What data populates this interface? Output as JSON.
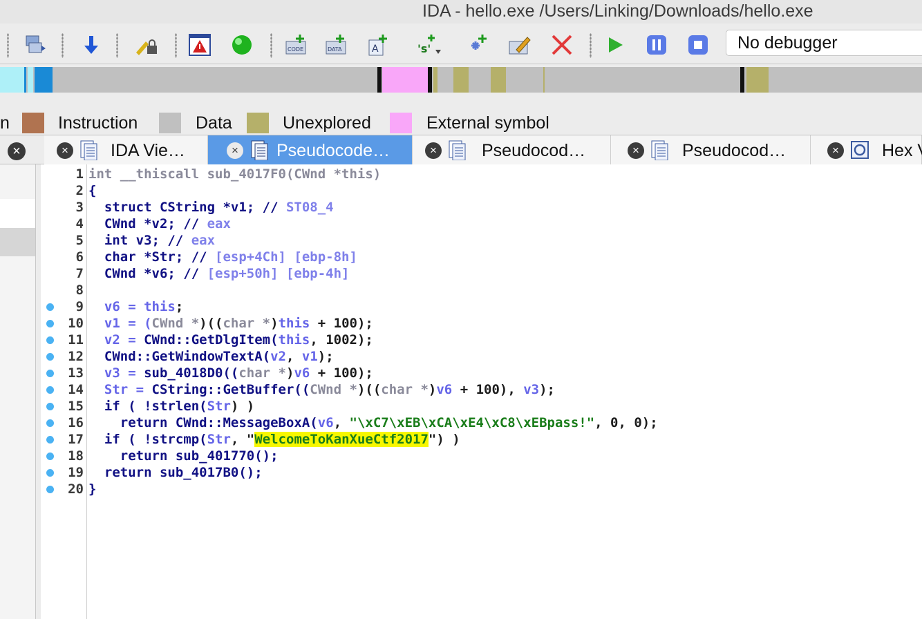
{
  "window": {
    "title": "IDA - hello.exe /Users/Linking/Downloads/hello.exe"
  },
  "toolbar": {
    "debugger_select": "No debugger",
    "icons": [
      "open-binary-icon",
      "jump-arrow-icon",
      "lock-key-icon",
      "warning-window-icon",
      "run-green-circle-icon",
      "code-add-icon",
      "data-add-icon",
      "string-add-icon",
      "segment-add-icon",
      "struct-add-icon",
      "edit-pencil-icon",
      "delete-x-icon",
      "play-icon",
      "pause-icon",
      "stop-icon"
    ]
  },
  "legend": {
    "items": [
      {
        "label": "n",
        "color": ""
      },
      {
        "label": "Instruction",
        "color": "#b07350"
      },
      {
        "label": "Data",
        "color": "#c0c0c0"
      },
      {
        "label": "Unexplored",
        "color": "#b5b06a"
      },
      {
        "label": "External symbol",
        "color": "#f9a7f9"
      }
    ]
  },
  "tabs": [
    {
      "label": "IDA Vie…",
      "active": false
    },
    {
      "label": "Pseudocode…",
      "active": true
    },
    {
      "label": "Pseudocod…",
      "active": false
    },
    {
      "label": "Pseudocod…",
      "active": false
    },
    {
      "label": "Hex V",
      "active": false
    }
  ],
  "editor": {
    "line_numbers": [
      "1",
      "2",
      "3",
      "4",
      "5",
      "6",
      "7",
      "8",
      "9",
      "10",
      "11",
      "12",
      "13",
      "14",
      "15",
      "16",
      "17",
      "18",
      "19",
      "20"
    ],
    "breakpoint_lines": [
      "9",
      "10",
      "11",
      "12",
      "13",
      "14",
      "15",
      "16",
      "17",
      "18",
      "19",
      "20"
    ],
    "lines": [
      [
        {
          "t": "int __thiscall sub_4017F0(CWnd *this)",
          "c": "ty"
        }
      ],
      [
        {
          "t": "{",
          "c": "kw"
        }
      ],
      [
        {
          "t": "  struct CString *v1; // ",
          "c": "kw"
        },
        {
          "t": "ST08_4",
          "c": "cm"
        }
      ],
      [
        {
          "t": "  CWnd *v2; // ",
          "c": "kw"
        },
        {
          "t": "eax",
          "c": "cm"
        }
      ],
      [
        {
          "t": "  int v3; // ",
          "c": "kw"
        },
        {
          "t": "eax",
          "c": "cm"
        }
      ],
      [
        {
          "t": "  char *Str; // ",
          "c": "kw"
        },
        {
          "t": "[esp+4Ch] [ebp-8h]",
          "c": "cm"
        }
      ],
      [
        {
          "t": "  CWnd *v6; // ",
          "c": "kw"
        },
        {
          "t": "[esp+50h] [ebp-4h]",
          "c": "cm"
        }
      ],
      [
        {
          "t": "",
          "c": "kw"
        }
      ],
      [
        {
          "t": "  v6 = ",
          "c": "vr"
        },
        {
          "t": "this",
          "c": "vr"
        },
        {
          "t": ";",
          "c": "pn"
        }
      ],
      [
        {
          "t": "  v1 = (",
          "c": "vr"
        },
        {
          "t": "CWnd *",
          "c": "ty"
        },
        {
          "t": ")((",
          "c": "pn"
        },
        {
          "t": "char *",
          "c": "ty"
        },
        {
          "t": ")",
          "c": "pn"
        },
        {
          "t": "this",
          "c": "vr"
        },
        {
          "t": " + 100);",
          "c": "pn"
        }
      ],
      [
        {
          "t": "  v2 = ",
          "c": "vr"
        },
        {
          "t": "CWnd::GetDlgItem(",
          "c": "kw"
        },
        {
          "t": "this",
          "c": "vr"
        },
        {
          "t": ", 1002);",
          "c": "pn"
        }
      ],
      [
        {
          "t": "  CWnd::GetWindowTextA(",
          "c": "kw"
        },
        {
          "t": "v2",
          "c": "vr"
        },
        {
          "t": ", ",
          "c": "pn"
        },
        {
          "t": "v1",
          "c": "vr"
        },
        {
          "t": ");",
          "c": "pn"
        }
      ],
      [
        {
          "t": "  v3 = ",
          "c": "vr"
        },
        {
          "t": "sub_4018D0((",
          "c": "kw"
        },
        {
          "t": "char *",
          "c": "ty"
        },
        {
          "t": ")",
          "c": "pn"
        },
        {
          "t": "v6",
          "c": "vr"
        },
        {
          "t": " + 100);",
          "c": "pn"
        }
      ],
      [
        {
          "t": "  Str = ",
          "c": "vr"
        },
        {
          "t": "CString::GetBuffer((",
          "c": "kw"
        },
        {
          "t": "CWnd *",
          "c": "ty"
        },
        {
          "t": ")((",
          "c": "pn"
        },
        {
          "t": "char *",
          "c": "ty"
        },
        {
          "t": ")",
          "c": "pn"
        },
        {
          "t": "v6",
          "c": "vr"
        },
        {
          "t": " + 100), ",
          "c": "pn"
        },
        {
          "t": "v3",
          "c": "vr"
        },
        {
          "t": ");",
          "c": "pn"
        }
      ],
      [
        {
          "t": "  if ( !strlen(",
          "c": "kw"
        },
        {
          "t": "Str",
          "c": "vr"
        },
        {
          "t": ") )",
          "c": "pn"
        }
      ],
      [
        {
          "t": "    return ",
          "c": "kw"
        },
        {
          "t": "CWnd::MessageBoxA(",
          "c": "kw"
        },
        {
          "t": "v6",
          "c": "vr"
        },
        {
          "t": ", ",
          "c": "pn"
        },
        {
          "t": "\"\\xC7\\xEB\\xCA\\xE4\\xC8\\xEBpass!\"",
          "c": "st"
        },
        {
          "t": ", 0, 0);",
          "c": "pn"
        }
      ],
      [
        {
          "t": "  if ( !strcmp(",
          "c": "kw"
        },
        {
          "t": "Str",
          "c": "vr"
        },
        {
          "t": ", \"",
          "c": "pn"
        },
        {
          "t": "WelcomeToKanXueCtf2017",
          "c": "hl"
        },
        {
          "t": "\") )",
          "c": "pn"
        }
      ],
      [
        {
          "t": "    return sub_401770();",
          "c": "kw"
        }
      ],
      [
        {
          "t": "  return sub_4017B0();",
          "c": "kw"
        }
      ],
      [
        {
          "t": "}",
          "c": "kw"
        }
      ]
    ]
  }
}
